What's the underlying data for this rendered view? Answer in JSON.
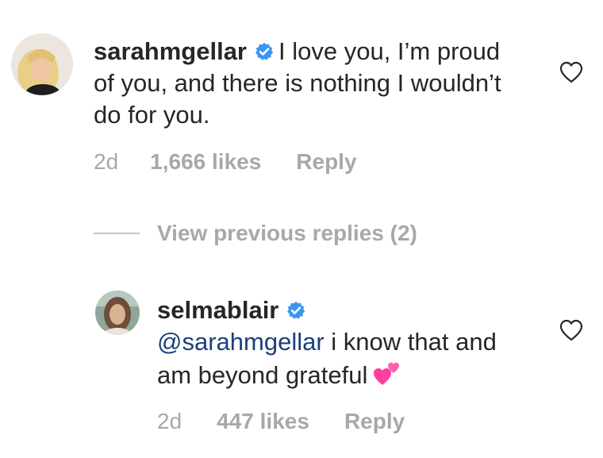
{
  "comment1": {
    "username": "sarahmgellar",
    "verified": true,
    "text": "I love you, I’m proud of you, and there is nothing I wouldn’t do for you.",
    "time": "2d",
    "likes": "1,666 likes",
    "reply_label": "Reply",
    "like_icon": "heart-outline-icon"
  },
  "view_replies": {
    "label": "View previous replies (2)"
  },
  "comment2": {
    "username": "selmablair",
    "verified": true,
    "mention": "@sarahmgellar",
    "text": " i know that and am beyond grateful",
    "emoji": "two-hearts-emoji",
    "time": "2d",
    "likes": "447 likes",
    "reply_label": "Reply",
    "like_icon": "heart-outline-icon"
  },
  "colors": {
    "verified_blue": "#3897f0",
    "meta_gray": "#a8a8a8",
    "mention_blue": "#1c3f7a",
    "emoji_pink": "#ff3d9a"
  }
}
